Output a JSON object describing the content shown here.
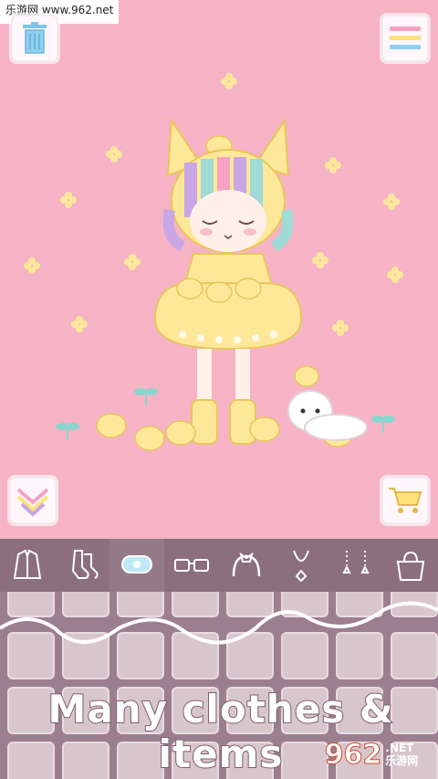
{
  "watermark_top": "乐游网 www.962.net",
  "caption": "Many clothes & items",
  "watermark_bottom": {
    "number": "962",
    "site_cn": "乐游网",
    "net": ".NET"
  },
  "buttons": {
    "trash_icon": "trash-icon",
    "menu_icon": "menu-icon",
    "down_icon": "chevron-down-icon",
    "cart_icon": "cart-icon"
  },
  "tabs": [
    {
      "name": "tab-outerwear",
      "icon": "jacket-icon"
    },
    {
      "name": "tab-socks",
      "icon": "socks-icon"
    },
    {
      "name": "tab-accessory",
      "icon": "hairclip-icon",
      "active": true
    },
    {
      "name": "tab-glasses",
      "icon": "glasses-icon"
    },
    {
      "name": "tab-headband",
      "icon": "headband-icon"
    },
    {
      "name": "tab-necklace",
      "icon": "necklace-icon"
    },
    {
      "name": "tab-earrings",
      "icon": "earrings-icon"
    },
    {
      "name": "tab-bag",
      "icon": "bag-icon"
    }
  ],
  "colors": {
    "background": "#f6b3c6",
    "tab_bar": "#8b6f7d",
    "grid": "#9c7f8e",
    "cell": "#d8c6cd",
    "accent_yellow": "#fde89a"
  }
}
